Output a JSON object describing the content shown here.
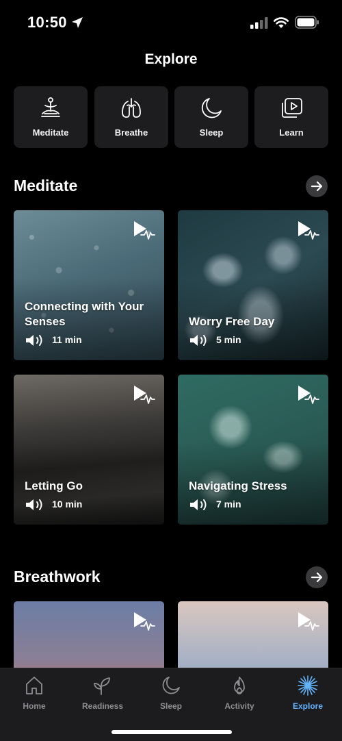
{
  "status": {
    "time": "10:50"
  },
  "page": {
    "title": "Explore"
  },
  "categories": [
    {
      "label": "Meditate",
      "icon": "meditate-icon"
    },
    {
      "label": "Breathe",
      "icon": "lungs-icon"
    },
    {
      "label": "Sleep",
      "icon": "moon-icon"
    },
    {
      "label": "Learn",
      "icon": "video-library-icon"
    }
  ],
  "sections": {
    "meditate": {
      "title": "Meditate",
      "cards": [
        {
          "title": "Connecting with Your Senses",
          "duration": "11 min"
        },
        {
          "title": "Worry Free Day",
          "duration": "5 min"
        },
        {
          "title": "Letting Go",
          "duration": "10 min"
        },
        {
          "title": "Navigating Stress",
          "duration": "7 min"
        }
      ]
    },
    "breathwork": {
      "title": "Breathwork"
    }
  },
  "tabs": [
    {
      "label": "Home",
      "icon": "home-icon"
    },
    {
      "label": "Readiness",
      "icon": "sprout-icon"
    },
    {
      "label": "Sleep",
      "icon": "moon-icon"
    },
    {
      "label": "Activity",
      "icon": "flame-icon"
    },
    {
      "label": "Explore",
      "icon": "sparkle-icon",
      "active": true
    }
  ],
  "colors": {
    "accent": "#63b5ff",
    "tile": "#1d1d1f",
    "tabbar": "#1c1c1e"
  }
}
